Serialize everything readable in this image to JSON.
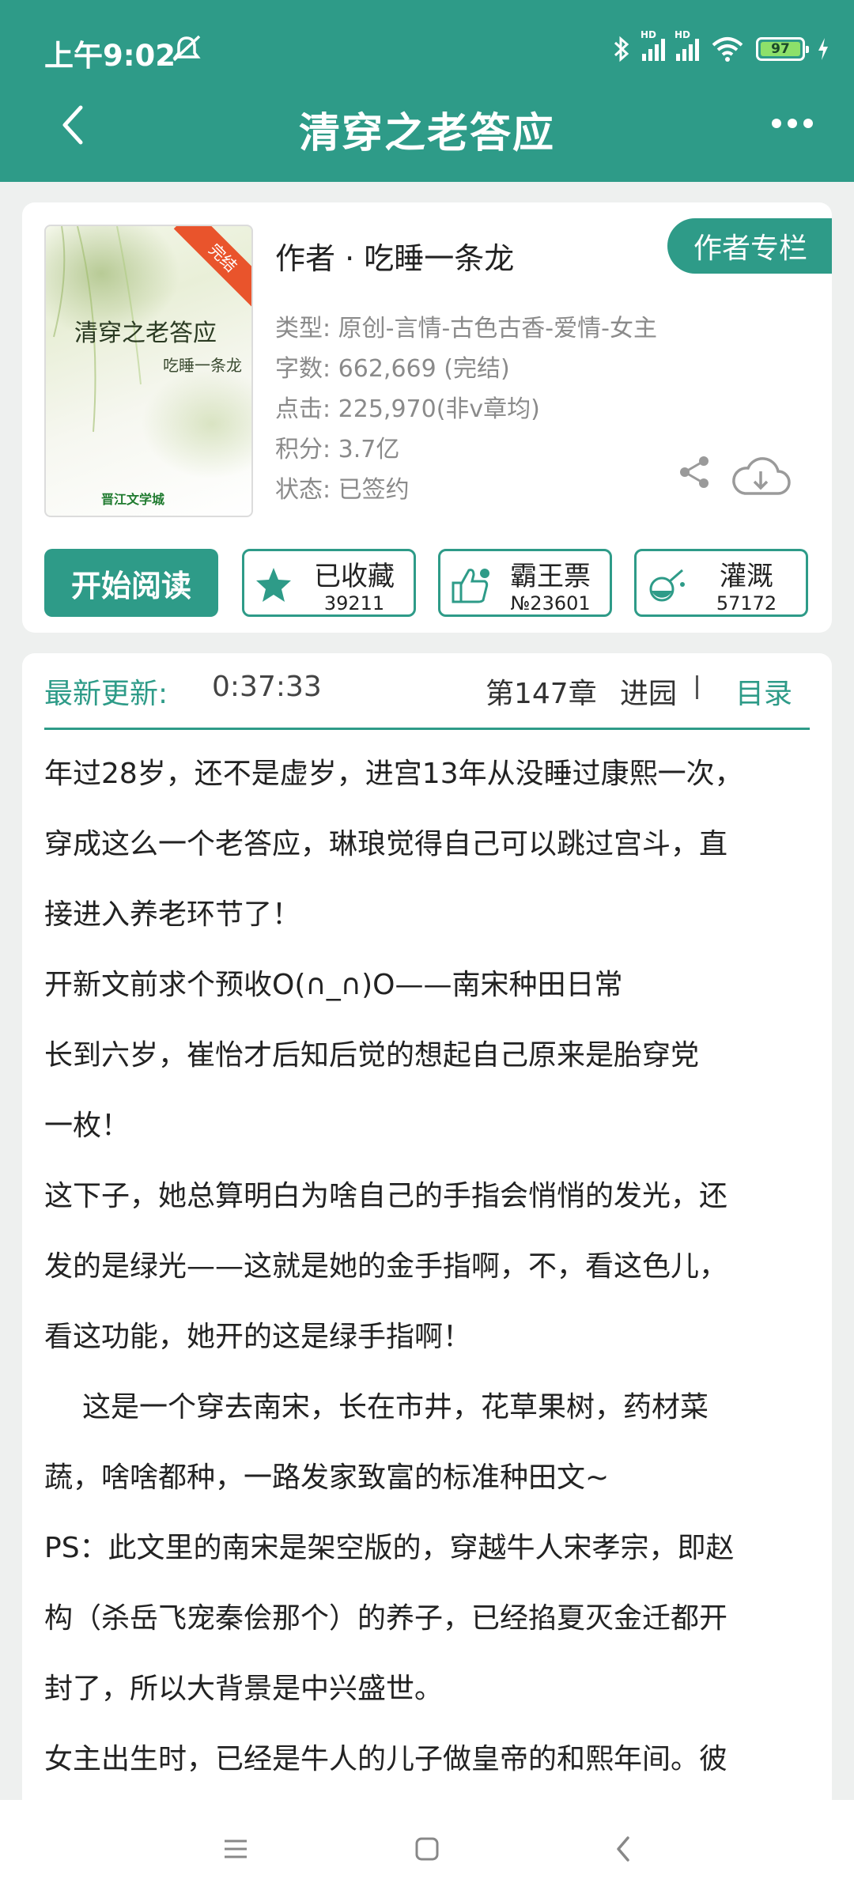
{
  "status_bar": {
    "time": "上午9:02",
    "battery": "97",
    "network_label": "HD"
  },
  "header": {
    "title": "清穿之老答应"
  },
  "book": {
    "cover_title": "清穿之老答应",
    "cover_author": "吃睡一条龙",
    "cover_badge": "完结",
    "cover_logo": "晋江文学城",
    "author_line": "作者 · 吃睡一条龙",
    "author_column_label": "作者专栏",
    "meta": {
      "type": "类型: 原创-言情-古色古香-爱情-女主",
      "words": "字数: 662,669 (完结)",
      "clicks": "点击: 225,970(非v章均)",
      "score": "积分: 3.7亿",
      "status": "状态: 已签约"
    }
  },
  "actions": {
    "read_label": "开始阅读",
    "collect": {
      "label": "已收藏",
      "count": "39211"
    },
    "vote": {
      "label": "霸王票",
      "count": "№23601"
    },
    "nutrient": {
      "label": "灌溉",
      "count": "57172"
    }
  },
  "update": {
    "label": "最新更新:",
    "time": "0:37:33",
    "chapter": "第147章",
    "chapter_title": "进园",
    "toc_label": "目录"
  },
  "description": {
    "lines": [
      "年过28岁，还不是虚岁，进宫13年从没睡过康熙一次，",
      "穿成这么一个老答应，琳琅觉得自己可以跳过宫斗，直",
      "接进入养老环节了！",
      "开新文前求个预收O(∩_∩)O——南宋种田日常",
      "长到六岁，崔怡才后知后觉的想起自己原来是胎穿党",
      "一枚！",
      "这下子，她总算明白为啥自己的手指会悄悄的发光，还",
      "发的是绿光——这就是她的金手指啊，不，看这色儿，",
      "看这功能，她开的这是绿手指啊！",
      "这是一个穿去南宋，长在市井，花草果树，药材菜",
      "蔬，啥啥都种，一路发家致富的标准种田文~",
      "PS：此文里的南宋是架空版的，穿越牛人宋孝宗，即赵",
      "构（杀岳飞宠秦侩那个）的养子，已经掐夏灭金迁都开",
      "封了，所以大背景是中兴盛世。",
      "女主出生时，已经是牛人的儿子做皇帝的和熙年间。彼"
    ]
  },
  "colors": {
    "accent": "#2e9b88",
    "badge": "#e9542c",
    "battery": "#8de06a"
  }
}
